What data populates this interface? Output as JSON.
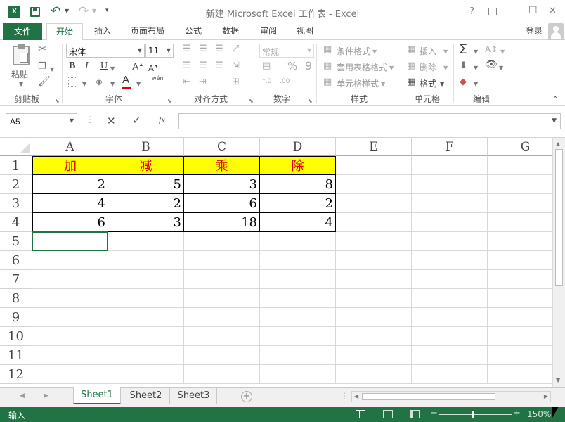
{
  "window": {
    "title": "新建 Microsoft Excel 工作表 - Excel",
    "help": "?",
    "minimize": "—",
    "maximize": "☐",
    "close": "✕"
  },
  "tabs": {
    "file": "文件",
    "home": "开始",
    "insert": "插入",
    "layout": "页面布局",
    "formulas": "公式",
    "data": "数据",
    "review": "审阅",
    "view": "视图",
    "login": "登录"
  },
  "ribbon": {
    "paste": "粘贴",
    "font_name": "宋体",
    "font_size": "11",
    "number_format": "常规",
    "wen": "wén",
    "percent": "%",
    "comma": "9",
    "cond_format": "条件格式",
    "table_format": "套用表格格式",
    "cell_style": "单元格样式",
    "insert": "插入",
    "delete": "删除",
    "format": "格式",
    "groups": {
      "clipboard": "剪贴板",
      "font": "字体",
      "alignment": "对齐方式",
      "number": "数字",
      "styles": "样式",
      "cells": "单元格",
      "editing": "编辑"
    }
  },
  "formula_bar": {
    "name_box": "A5",
    "fx": "fx",
    "formula": ""
  },
  "columns": [
    "A",
    "B",
    "C",
    "D",
    "E",
    "F",
    "G"
  ],
  "rows": [
    "1",
    "2",
    "3",
    "4",
    "5",
    "6",
    "7",
    "8",
    "9",
    "10",
    "11",
    "12"
  ],
  "cells": {
    "header": [
      "加",
      "减",
      "乘",
      "除"
    ],
    "r2": [
      "2",
      "5",
      "3",
      "8"
    ],
    "r3": [
      "4",
      "2",
      "6",
      "2"
    ],
    "r4": [
      "6",
      "3",
      "18",
      "4"
    ]
  },
  "sheets": [
    "Sheet1",
    "Sheet2",
    "Sheet3"
  ],
  "status": {
    "mode": "输入",
    "zoom": "150%"
  },
  "colors": {
    "excel_green": "#217346",
    "header_fill": "#ffff00",
    "header_text": "#e00000"
  }
}
